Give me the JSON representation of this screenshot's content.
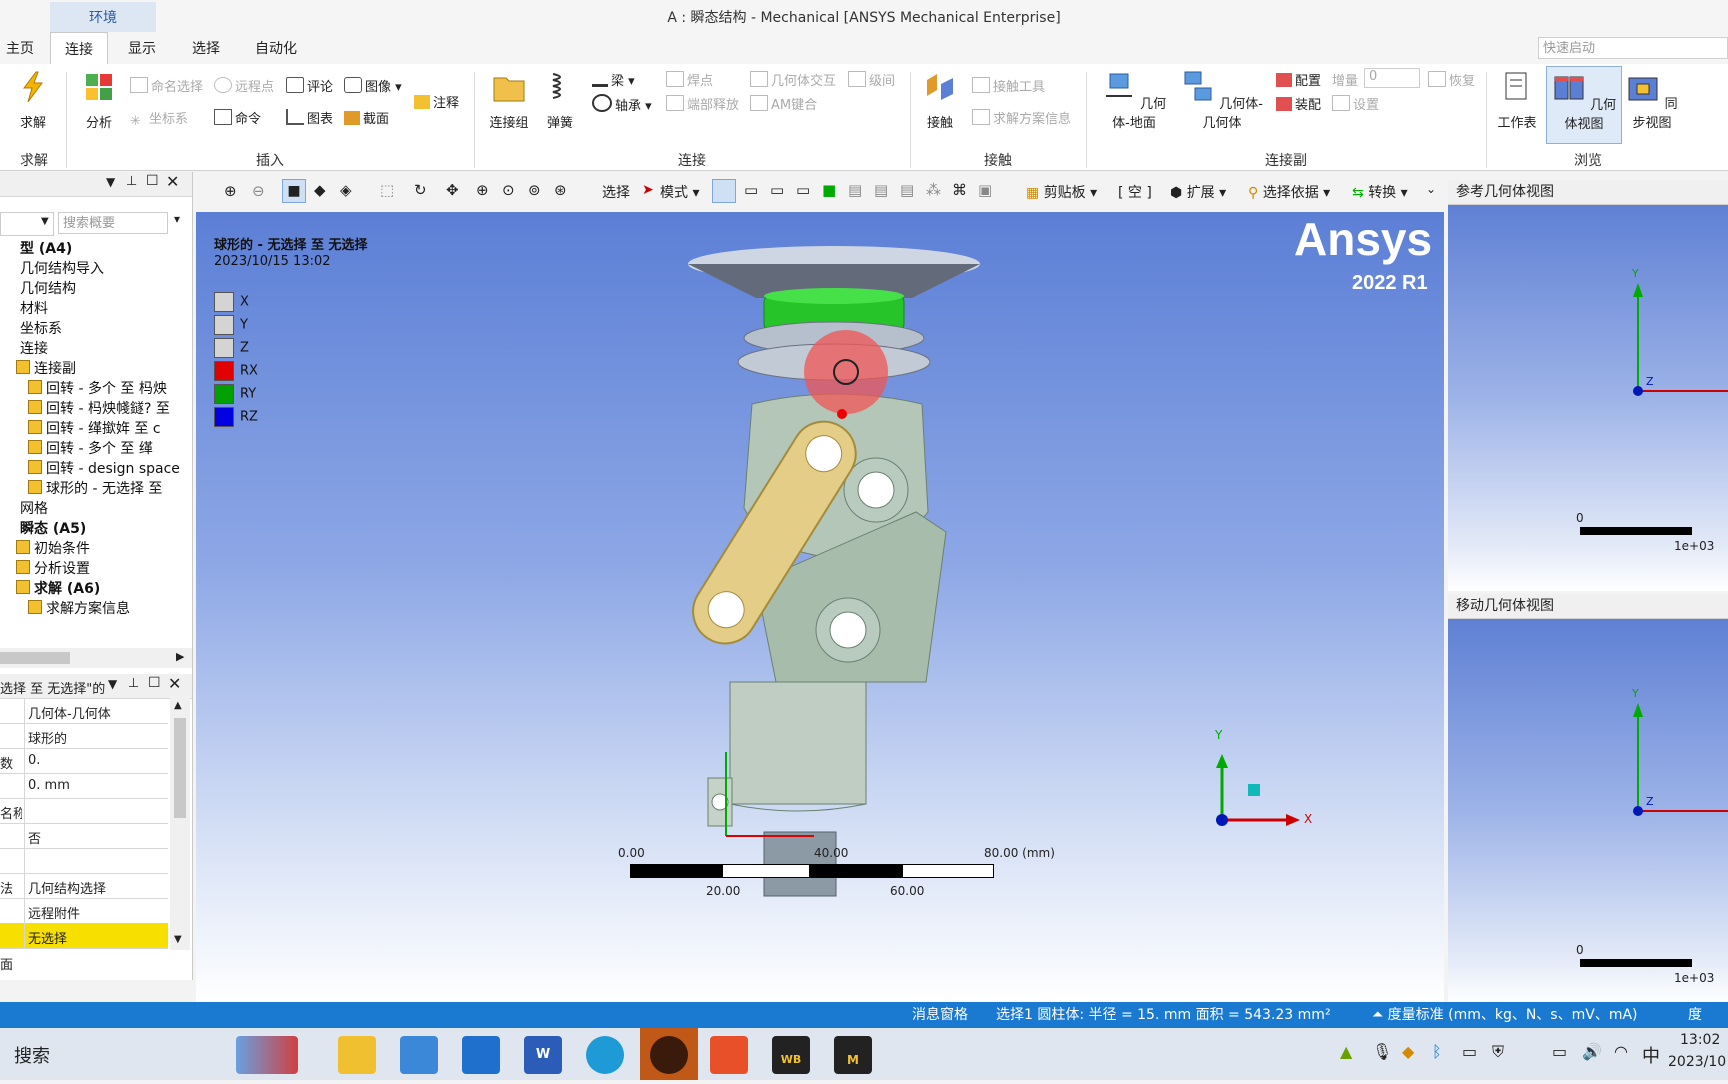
{
  "window": {
    "title": "A : 瞬态结构 - Mechanical [ANSYS Mechanical Enterprise]",
    "context_tab": "环境"
  },
  "menu_tabs": [
    "主页",
    "连接",
    "显示",
    "选择",
    "自动化"
  ],
  "active_menu_tab": "连接",
  "quick_launch": {
    "placeholder": "快速启动"
  },
  "ribbon": {
    "solve": {
      "label": "求解",
      "group": "求解"
    },
    "analysis": {
      "label": "分析"
    },
    "insert": {
      "group": "插入",
      "named_selection": "命名选择",
      "remote_point": "远程点",
      "comment": "评论",
      "image": "图像",
      "coordinate_system": "坐标系",
      "command": "命令",
      "chart": "图表",
      "section": "截面",
      "annotation": "注释"
    },
    "connect": {
      "group": "连接",
      "connection_group": "连接组",
      "spring": "弹簧",
      "beam": "梁",
      "bearing": "轴承",
      "spot_weld": "焊点",
      "end_release": "端部释放",
      "body_interaction": "几何体交互",
      "am_bond": "AM键合",
      "joint_level": "级间"
    },
    "contact": {
      "group": "接触",
      "contact": "接触",
      "contact_tool": "接触工具",
      "solution_info": "求解方案信息"
    },
    "joints": {
      "group": "连接副",
      "body_ground": "几何体-地面",
      "body_body": "几何体-几何体",
      "configure": "配置",
      "assemble": "装配",
      "increment_label": "增量",
      "increment_value": "0",
      "restore": "恢复",
      "settings": "设置"
    },
    "browse": {
      "group": "浏览",
      "worksheet": "工作表",
      "body_views": "几何体视图",
      "sync_views": "同步视图"
    }
  },
  "tree": {
    "search_placeholder": "搜索概要",
    "items": [
      {
        "label": "型 (A4)",
        "indent": 0,
        "bold": true
      },
      {
        "label": "几何结构导入",
        "indent": 0
      },
      {
        "label": "几何结构",
        "indent": 0
      },
      {
        "label": "材料",
        "indent": 0
      },
      {
        "label": "坐标系",
        "indent": 0
      },
      {
        "label": "连接",
        "indent": 0
      },
      {
        "label": "连接副",
        "indent": 1
      },
      {
        "label": "回转 - 多个 至 杩炴",
        "indent": 2
      },
      {
        "label": "回转 - 杩炴帴鐩? 至",
        "indent": 2
      },
      {
        "label": "回转 - 缂撳姩 至 c",
        "indent": 2
      },
      {
        "label": "回转 - 多个 至 缂",
        "indent": 2
      },
      {
        "label": "回转 - design space",
        "indent": 2
      },
      {
        "label": "球形的 - 无选择 至",
        "indent": 2
      },
      {
        "label": "网格",
        "indent": 0
      },
      {
        "label": "瞬态 (A5)",
        "indent": 0,
        "bold": true
      },
      {
        "label": "初始条件",
        "indent": 1
      },
      {
        "label": "分析设置",
        "indent": 1
      },
      {
        "label": "求解 (A6)",
        "indent": 1,
        "bold": true
      },
      {
        "label": "求解方案信息",
        "indent": 2
      }
    ]
  },
  "details": {
    "header": "选择 至 无选择\"的",
    "rows": [
      {
        "key": "",
        "value": "几何体-几何体"
      },
      {
        "key": "",
        "value": "球形的"
      },
      {
        "key": "数",
        "value": "0."
      },
      {
        "key": "",
        "value": "0. mm"
      },
      {
        "key": "名称",
        "value": ""
      },
      {
        "key": "",
        "value": "否"
      },
      {
        "key": "",
        "value": ""
      },
      {
        "key": "法",
        "value": "几何结构选择"
      },
      {
        "key": "",
        "value": "远程附件"
      },
      {
        "key": "",
        "value": "无选择"
      }
    ],
    "footer": "面"
  },
  "viewport_toolbar": {
    "select": "选择",
    "mode": "模式",
    "clipboard": "剪贴板",
    "empty": "[ 空 ]",
    "extend": "扩展",
    "select_by": "选择依据",
    "convert": "转换"
  },
  "viewport": {
    "joint_title": "球形的 - 无选择 至 无选择",
    "timestamp": "2023/10/15 13:02",
    "dofs": [
      {
        "label": "X",
        "color": "#d4d4d4"
      },
      {
        "label": "Y",
        "color": "#d4d4d4"
      },
      {
        "label": "Z",
        "color": "#d4d4d4"
      },
      {
        "label": "RX",
        "color": "#e00000"
      },
      {
        "label": "RY",
        "color": "#00a000"
      },
      {
        "label": "RZ",
        "color": "#0000e0"
      }
    ],
    "brand": "Ansys",
    "version": "2022 R1",
    "scale": {
      "t0": "0.00",
      "t40": "40.00",
      "t80": "80.00 (mm)",
      "t20": "20.00",
      "t60": "60.00"
    },
    "triad": {
      "x": "X",
      "y": "Y"
    }
  },
  "reference_view": {
    "title": "参考几何体视图",
    "scale_zero": "0",
    "scale_max": "1e+03",
    "y": "Y",
    "z": "Z"
  },
  "mobile_view": {
    "title": "移动几何体视图",
    "scale_zero": "0",
    "scale_max": "1e+03",
    "y": "Y",
    "z": "Z"
  },
  "status_bar": {
    "messages": "消息窗格",
    "selection": "选择1 圆柱体: 半径 = 15. mm  面积 = 543.23 mm²",
    "units": "度量标准 (mm、kg、N、s、mV、mA)",
    "angle": "度"
  },
  "taskbar": {
    "search": "搜索",
    "ime": "中",
    "time": "13:02",
    "date": "2023/10",
    "wb_label": "WB",
    "m_label": "M"
  },
  "colors": {
    "accent": "#1a79d0",
    "link_yellow": "#e4cd86",
    "body_green": "#b9cbbf",
    "cap_green": "#22c322"
  }
}
